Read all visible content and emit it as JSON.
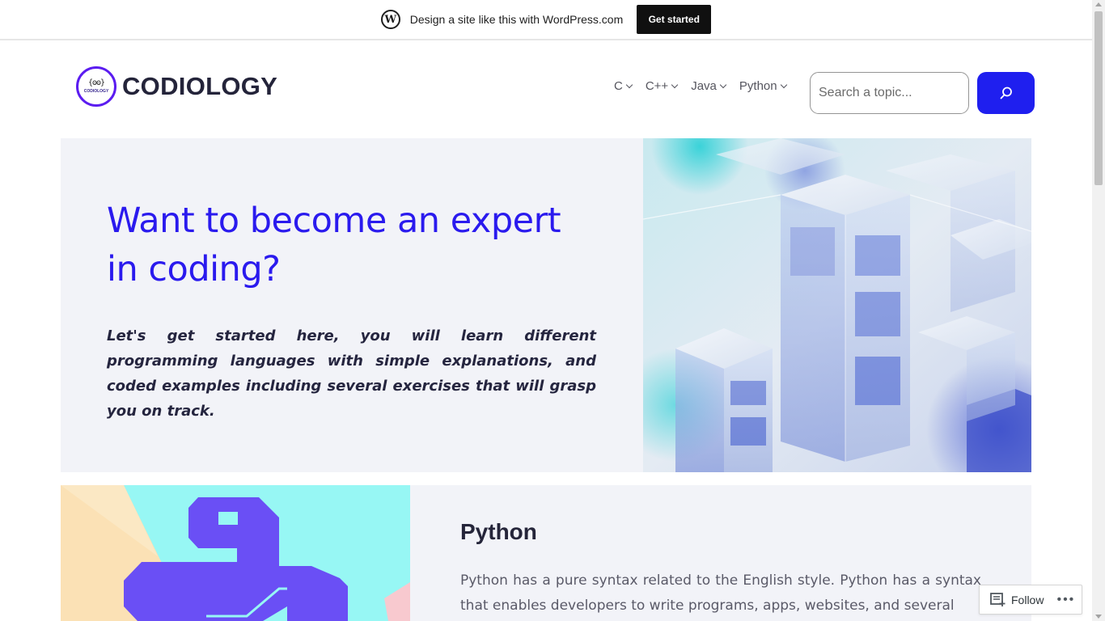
{
  "wp_bar": {
    "text": "Design a site like this with WordPress.com",
    "button": "Get started"
  },
  "header": {
    "logo_glyph": "{ʘʘ}",
    "logo_small": "CODIOLOGY",
    "site_name": "CODIOLOGY",
    "nav": [
      {
        "label": "C"
      },
      {
        "label": "C++"
      },
      {
        "label": "Java"
      },
      {
        "label": "Python"
      }
    ],
    "search": {
      "placeholder": "Search a topic..."
    }
  },
  "hero": {
    "title": "Want to become an expert in coding?",
    "lead": "Let's get started here, you will learn different programming languages with simple explanations, and coded examples including several exercises that will grasp you on track."
  },
  "python_section": {
    "heading": "Python",
    "body": "Python has a pure syntax related to the English style. Python has a syntax that enables developers to write programs, apps, websites, and several"
  },
  "follow_widget": {
    "label": "Follow",
    "more": "•••"
  },
  "colors": {
    "accent": "#1f1fef",
    "hero_title": "#2a1aee",
    "panel_bg": "#f2f3f8"
  }
}
